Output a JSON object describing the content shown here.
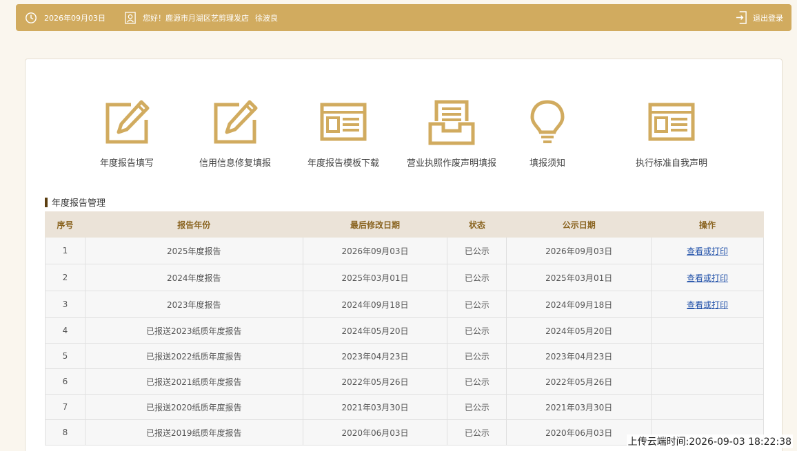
{
  "header": {
    "date": "2026年09月03日",
    "greeting": "您好！鹿源市月湖区艺剪理发店",
    "username": "徐波良",
    "logout_label": "退出登录"
  },
  "nav": [
    {
      "label": "年度报告填写",
      "icon": "edit-icon"
    },
    {
      "label": "信用信息修复填报",
      "icon": "edit-icon"
    },
    {
      "label": "年度报告模板下载",
      "icon": "template-icon"
    },
    {
      "label": "营业执照作废声明填报",
      "icon": "inbox-icon"
    },
    {
      "label": "填报须知",
      "icon": "lightbulb-icon"
    },
    {
      "label": "执行标准自我声明",
      "icon": "template-icon"
    }
  ],
  "section_title": "年度报告管理",
  "table": {
    "headers": [
      "序号",
      "报告年份",
      "最后修改日期",
      "状态",
      "公示日期",
      "操作"
    ],
    "rows": [
      {
        "no": "1",
        "year": "2025年度报告",
        "modified": "2026年09月03日",
        "status": "已公示",
        "published": "2026年09月03日",
        "action": "查看或打印"
      },
      {
        "no": "2",
        "year": "2024年度报告",
        "modified": "2025年03月01日",
        "status": "已公示",
        "published": "2025年03月01日",
        "action": "查看或打印"
      },
      {
        "no": "3",
        "year": "2023年度报告",
        "modified": "2024年09月18日",
        "status": "已公示",
        "published": "2024年09月18日",
        "action": "查看或打印"
      },
      {
        "no": "4",
        "year": "已报送2023纸质年度报告",
        "modified": "2024年05月20日",
        "status": "已公示",
        "published": "2024年05月20日",
        "action": ""
      },
      {
        "no": "5",
        "year": "已报送2022纸质年度报告",
        "modified": "2023年04月23日",
        "status": "已公示",
        "published": "2023年04月23日",
        "action": ""
      },
      {
        "no": "6",
        "year": "已报送2021纸质年度报告",
        "modified": "2022年05月26日",
        "status": "已公示",
        "published": "2022年05月26日",
        "action": ""
      },
      {
        "no": "7",
        "year": "已报送2020纸质年度报告",
        "modified": "2021年03月30日",
        "status": "已公示",
        "published": "2021年03月30日",
        "action": ""
      },
      {
        "no": "8",
        "year": "已报送2019纸质年度报告",
        "modified": "2020年06月03日",
        "status": "已公示",
        "published": "2020年06月03日",
        "action": ""
      }
    ]
  },
  "upload_time": "上传云端时间:2026-09-03 18:22:38",
  "colors": {
    "accent": "#d1ab5f",
    "header_bg": "#ebe3d8",
    "link": "#1f4fa8"
  }
}
